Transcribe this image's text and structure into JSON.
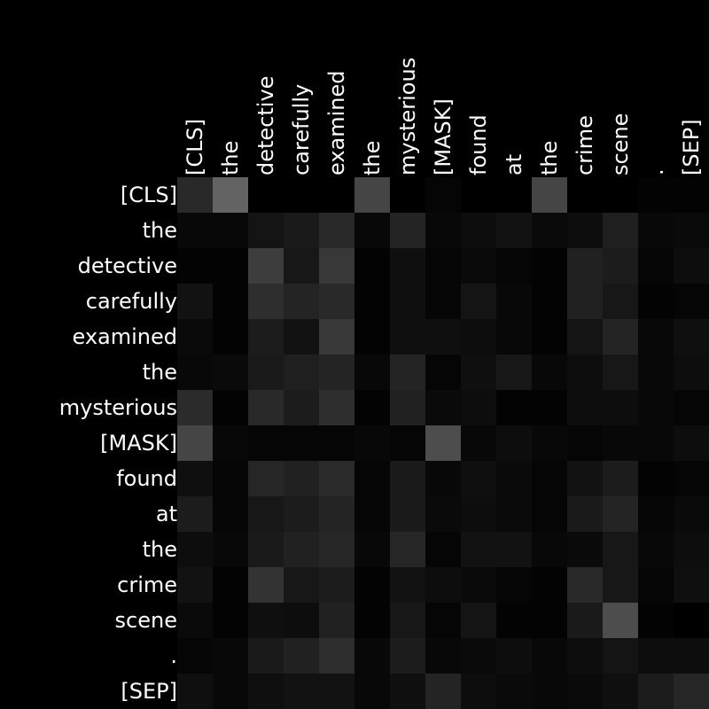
{
  "chart_data": {
    "type": "heatmap",
    "title": "",
    "xlabel": "",
    "ylabel": "",
    "x_tokens": [
      "[CLS]",
      "the",
      "detective",
      "carefully",
      "examined",
      "the",
      "mysterious",
      "[MASK]",
      "found",
      "at",
      "the",
      "crime",
      "scene",
      ".",
      "[SEP]"
    ],
    "y_tokens": [
      "[CLS]",
      "the",
      "detective",
      "carefully",
      "examined",
      "the",
      "mysterious",
      "[MASK]",
      "found",
      "at",
      "the",
      "crime",
      "scene",
      ".",
      "[SEP]"
    ],
    "colormap": "grayscale",
    "value_range": [
      0,
      1
    ],
    "grid": false,
    "legend": "none",
    "values": [
      [
        0.16,
        0.39,
        0.0,
        0.0,
        0.0,
        0.27,
        0.0,
        0.02,
        0.0,
        0.0,
        0.27,
        0.0,
        0.0,
        0.01,
        0.01
      ],
      [
        0.03,
        0.03,
        0.08,
        0.1,
        0.16,
        0.03,
        0.14,
        0.03,
        0.05,
        0.07,
        0.04,
        0.05,
        0.12,
        0.03,
        0.04
      ],
      [
        0.01,
        0.01,
        0.24,
        0.09,
        0.22,
        0.01,
        0.06,
        0.02,
        0.04,
        0.02,
        0.01,
        0.13,
        0.11,
        0.02,
        0.05
      ],
      [
        0.07,
        0.01,
        0.18,
        0.14,
        0.16,
        0.01,
        0.06,
        0.02,
        0.08,
        0.03,
        0.01,
        0.13,
        0.09,
        0.01,
        0.02
      ],
      [
        0.04,
        0.01,
        0.11,
        0.07,
        0.22,
        0.01,
        0.06,
        0.06,
        0.05,
        0.03,
        0.01,
        0.08,
        0.14,
        0.03,
        0.06
      ],
      [
        0.03,
        0.04,
        0.1,
        0.12,
        0.14,
        0.03,
        0.14,
        0.02,
        0.06,
        0.09,
        0.03,
        0.05,
        0.09,
        0.03,
        0.05
      ],
      [
        0.17,
        0.01,
        0.16,
        0.11,
        0.18,
        0.01,
        0.13,
        0.04,
        0.05,
        0.01,
        0.01,
        0.05,
        0.05,
        0.03,
        0.02
      ],
      [
        0.27,
        0.03,
        0.02,
        0.02,
        0.02,
        0.03,
        0.02,
        0.3,
        0.03,
        0.05,
        0.03,
        0.02,
        0.03,
        0.03,
        0.05
      ],
      [
        0.06,
        0.02,
        0.15,
        0.13,
        0.17,
        0.02,
        0.1,
        0.03,
        0.06,
        0.04,
        0.02,
        0.07,
        0.11,
        0.01,
        0.02
      ],
      [
        0.11,
        0.02,
        0.09,
        0.11,
        0.14,
        0.02,
        0.1,
        0.04,
        0.05,
        0.04,
        0.02,
        0.1,
        0.14,
        0.02,
        0.04
      ],
      [
        0.05,
        0.03,
        0.1,
        0.13,
        0.15,
        0.03,
        0.15,
        0.02,
        0.07,
        0.07,
        0.03,
        0.04,
        0.09,
        0.03,
        0.05
      ],
      [
        0.07,
        0.01,
        0.2,
        0.09,
        0.11,
        0.01,
        0.07,
        0.05,
        0.04,
        0.02,
        0.01,
        0.16,
        0.09,
        0.02,
        0.06
      ],
      [
        0.04,
        0.01,
        0.06,
        0.05,
        0.13,
        0.01,
        0.09,
        0.02,
        0.08,
        0.01,
        0.01,
        0.1,
        0.3,
        0.01,
        0.0
      ],
      [
        0.02,
        0.03,
        0.1,
        0.13,
        0.18,
        0.03,
        0.11,
        0.03,
        0.04,
        0.05,
        0.03,
        0.05,
        0.08,
        0.05,
        0.05
      ],
      [
        0.06,
        0.03,
        0.06,
        0.07,
        0.07,
        0.03,
        0.06,
        0.14,
        0.05,
        0.04,
        0.03,
        0.04,
        0.06,
        0.11,
        0.15
      ]
    ]
  }
}
